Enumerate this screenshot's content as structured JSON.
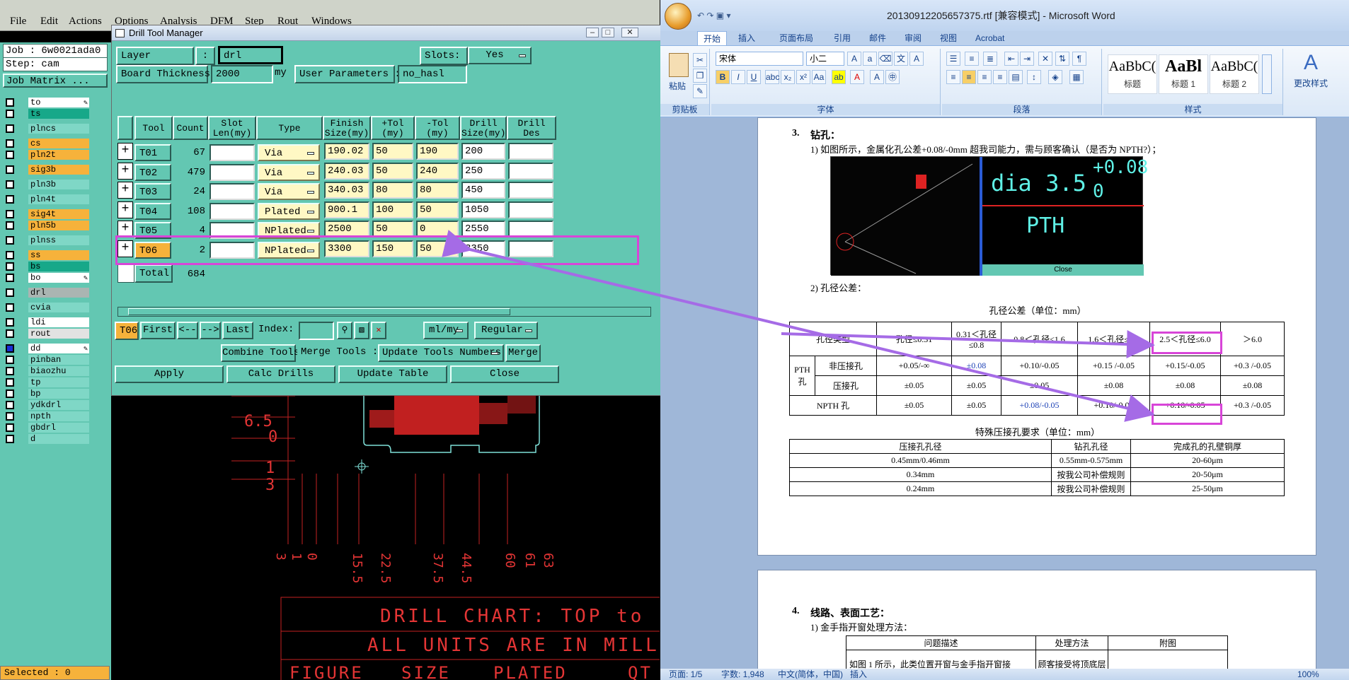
{
  "genesis": {
    "menu": [
      "File",
      "Edit",
      "Actions",
      "Options",
      "Analysis",
      "DFM",
      "Step",
      "Rout",
      "Windows"
    ],
    "job_label": "Job : 6w0021ada0",
    "step_label": "Step: cam",
    "job_matrix_btn": "Job Matrix ...",
    "layers": [
      {
        "name": "to",
        "color": "#ffffff",
        "edit": true
      },
      {
        "name": "ts",
        "color": "#17a889"
      },
      {
        "gap": true
      },
      {
        "name": "plncs",
        "color": "#7fd7c6"
      },
      {
        "gap": true
      },
      {
        "name": "cs",
        "color": "#f6b23b"
      },
      {
        "name": "pln2t",
        "color": "#f6b23b"
      },
      {
        "gap": true
      },
      {
        "name": "sig3b",
        "color": "#f6b23b"
      },
      {
        "gap": true
      },
      {
        "name": "pln3b",
        "color": "#7fd7c6"
      },
      {
        "gap": true
      },
      {
        "name": "pln4t",
        "color": "#7fd7c6"
      },
      {
        "gap": true
      },
      {
        "name": "sig4t",
        "color": "#f6b23b"
      },
      {
        "name": "pln5b",
        "color": "#f6b23b"
      },
      {
        "gap": true
      },
      {
        "name": "plnss",
        "color": "#7fd7c6"
      },
      {
        "gap": true
      },
      {
        "name": "ss",
        "color": "#f6b23b"
      },
      {
        "name": "bs",
        "color": "#17a889"
      },
      {
        "name": "bo",
        "color": "#ffffff",
        "edit": true
      },
      {
        "gap": true
      },
      {
        "name": "drl",
        "color": "#aab5b2"
      },
      {
        "gap": true
      },
      {
        "name": "cvia",
        "color": "#7fd7c6"
      },
      {
        "gap": true
      },
      {
        "name": "ldi",
        "color": "#ffffff"
      },
      {
        "name": "rout",
        "color": "#e2e2e2"
      },
      {
        "gap": true
      },
      {
        "name": "dd",
        "color": "#ffffff",
        "edit": true,
        "checked": true
      },
      {
        "name": "pinban",
        "color": "#7fd7c6"
      },
      {
        "name": "biaozhu",
        "color": "#7fd7c6"
      },
      {
        "name": "tp",
        "color": "#7fd7c6"
      },
      {
        "name": "bp",
        "color": "#7fd7c6"
      },
      {
        "name": "ydkdrl",
        "color": "#7fd7c6"
      },
      {
        "name": "npth",
        "color": "#7fd7c6"
      },
      {
        "name": "gbdrl",
        "color": "#7fd7c6"
      },
      {
        "name": "d",
        "color": "#7fd7c6"
      }
    ],
    "selected": "Selected : 0",
    "canvas": {
      "labels_left": [
        "6.5",
        "0",
        "1",
        "3"
      ],
      "labels_bottom": [
        "3",
        "1",
        "0",
        "15.5",
        "22.5",
        "37.5",
        "44.5",
        "60",
        "61",
        "63"
      ],
      "chart_line1": "DRILL CHART: TOP to B",
      "chart_line2": "ALL UNITS ARE IN MILL",
      "chart_line3": [
        "FIGURE",
        "SIZE",
        "PLATED",
        "QT"
      ]
    }
  },
  "dtm": {
    "title": "Drill Tool Manager",
    "layer_label": "Layer",
    "layer_colon": ":",
    "layer_value": "drl",
    "slots_label": "Slots:",
    "slots_value": "Yes",
    "board_thickness_label": "Board Thickness :",
    "board_thickness_value": "2000",
    "board_thickness_unit": "my",
    "user_params_label": "User Parameters :",
    "user_params_value": "no_hasl",
    "headers": [
      "Tool",
      "Count",
      "Slot\nLen(my)",
      "Type",
      "Finish\nSize(my)",
      "+Tol\n(my)",
      "-Tol\n(my)",
      "Drill\nSize(my)",
      "Drill\nDes"
    ],
    "rows": [
      {
        "tool": "T01",
        "count": "67",
        "type": "Via",
        "finish": "190.02",
        "ptol": "50",
        "ntol": "190",
        "drill": "200"
      },
      {
        "tool": "T02",
        "count": "479",
        "type": "Via",
        "finish": "240.03",
        "ptol": "50",
        "ntol": "240",
        "drill": "250"
      },
      {
        "tool": "T03",
        "count": "24",
        "type": "Via",
        "finish": "340.03",
        "ptol": "80",
        "ntol": "80",
        "drill": "450"
      },
      {
        "tool": "T04",
        "count": "108",
        "type": "Plated",
        "finish": "900.1",
        "ptol": "100",
        "ntol": "50",
        "drill": "1050"
      },
      {
        "tool": "T05",
        "count": "4",
        "type": "NPlated",
        "finish": "2500",
        "ptol": "50",
        "ntol": "0",
        "drill": "2550"
      },
      {
        "tool": "T06",
        "count": "2",
        "type": "NPlated",
        "finish": "3300",
        "ptol": "150",
        "ntol": "50",
        "drill": "3350",
        "selected": true
      }
    ],
    "total_label": "Total",
    "total_value": "684",
    "nav_current": "T06",
    "nav_first": "First",
    "nav_prev": "<--",
    "nav_next": "-->",
    "nav_last": "Last",
    "index_label": "Index:",
    "units_value": "ml/my",
    "mode_value": "Regular",
    "combine_btn": "Combine Tools",
    "merge_label": "Merge Tools :",
    "update_numbers_value": "Update Tools Numbers",
    "merge_btn": "Merge",
    "apply_btn": "Apply",
    "calc_btn": "Calc Drills",
    "update_table_btn": "Update Table",
    "close_btn": "Close"
  },
  "word": {
    "title": "20130912205657375.rtf [兼容模式] - Microsoft Word",
    "tabs": [
      "开始",
      "插入",
      "页面布局",
      "引用",
      "邮件",
      "审阅",
      "视图",
      "Acrobat"
    ],
    "font_name": "宋体",
    "font_size": "小二",
    "groups": [
      "剪贴板",
      "字体",
      "段落",
      "样式"
    ],
    "paste_label": "粘贴",
    "styles": [
      {
        "preview": "AaBbC(",
        "label": "标题"
      },
      {
        "preview": "AaBl",
        "label": "标题 1"
      },
      {
        "preview": "AaBbC(",
        "label": "标题 2"
      }
    ],
    "change_styles": "更改样式",
    "section3_num": "3.",
    "section3_title": "钻孔：",
    "item1": "1)  如图所示，金属化孔公差+0.08/-0mm 超我司能力，需与顾客确认（是否为 NPTH?）；",
    "inset": {
      "dia": "dia 3.5",
      "plus": "+0.08",
      "minus": "0",
      "pth": "PTH",
      "close": "Close"
    },
    "item2": "2)  孔径公差：",
    "table_caption": "孔径公差（单位：mm）",
    "tol_table": {
      "header": [
        "孔径类型",
        "孔径≤0.31",
        "0.31＜孔径≤0.8",
        "0.8＜孔径≤1.6",
        "1.6＜孔径≤2.5",
        "2.5＜孔径≤6.0",
        "＞6.0"
      ],
      "pth_group": "PTH 孔",
      "rows": [
        {
          "label": "非压接孔",
          "values": [
            "+0.05/-∞",
            "±0.08",
            "+0.10/-0.05",
            "+0.15 /-0.05",
            "+0.15/-0.05",
            "+0.3 /-0.05"
          ]
        },
        {
          "label": "压接孔",
          "values": [
            "±0.05",
            "±0.05",
            "±0.05",
            "±0.08",
            "±0.08",
            "±0.08"
          ]
        },
        {
          "label": "NPTH 孔",
          "values": [
            "±0.05",
            "±0.05",
            "+0.08/-0.05",
            "+0.10/-0.05",
            "+0.10/-0.05",
            "+0.3 /-0.05"
          ]
        }
      ]
    },
    "special_caption": "特殊压接孔要求（单位：mm）",
    "special_table": {
      "header": [
        "压接孔孔径",
        "钻孔孔径",
        "完成孔的孔壁铜厚"
      ],
      "rows": [
        [
          "0.45mm/0.46mm",
          "0.55mm-0.575mm",
          "20-60μm"
        ],
        [
          "0.34mm",
          "按我公司补偿规则",
          "20-50μm"
        ],
        [
          "0.24mm",
          "按我公司补偿规则",
          "25-50μm"
        ]
      ]
    },
    "section4_num": "4.",
    "section4_title": "线路、表面工艺：",
    "item4_1": "1)  金手指开窗处理方法：",
    "sec4_table": {
      "header": [
        "问题描述",
        "处理方法",
        "附图"
      ],
      "row1": [
        "如图 1 所示，此类位置开窗与金手指开窗接",
        "顾客接受将顶底层"
      ]
    },
    "status": {
      "page": "页面: 1/5",
      "words": "字数: 1,948",
      "lang": "中文(简体，中国)",
      "insert": "插入",
      "zoom": "100%"
    }
  }
}
